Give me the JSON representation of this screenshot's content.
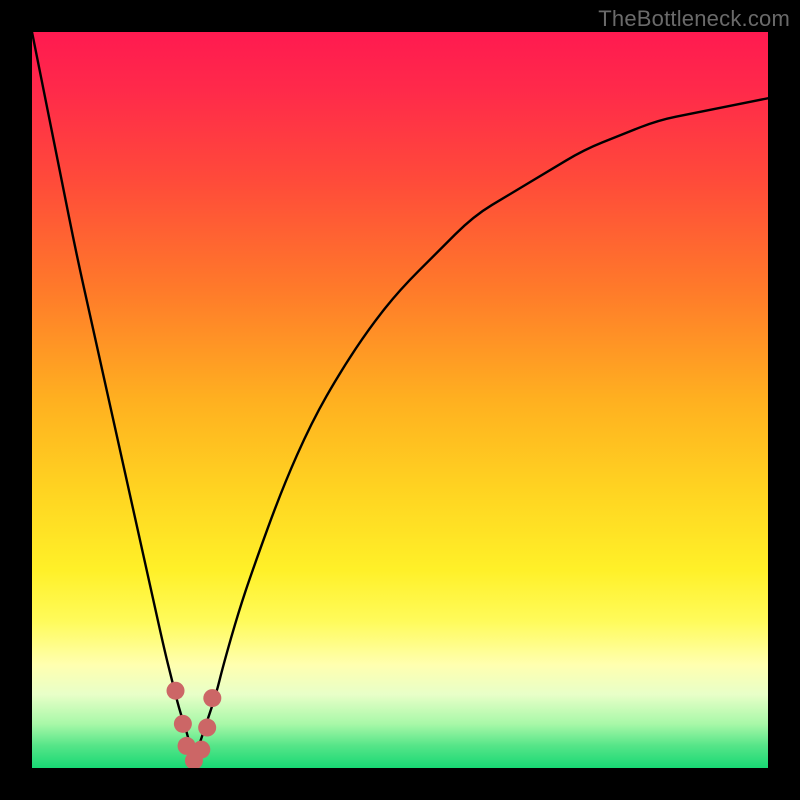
{
  "attribution": "TheBottleneck.com",
  "chart_data": {
    "type": "line",
    "title": "",
    "xlabel": "",
    "ylabel": "",
    "xlim": [
      0,
      100
    ],
    "ylim": [
      0,
      100
    ],
    "min_x": 22,
    "series": [
      {
        "name": "bottleneck-curve",
        "x": [
          0,
          2,
          4,
          6,
          8,
          10,
          12,
          14,
          16,
          18,
          19,
          20,
          21,
          22,
          23,
          24,
          25,
          26,
          28,
          30,
          34,
          38,
          42,
          46,
          50,
          55,
          60,
          65,
          70,
          75,
          80,
          85,
          90,
          95,
          100
        ],
        "y": [
          100,
          90,
          80,
          70,
          61,
          52,
          43,
          34,
          25,
          16,
          12,
          8,
          5,
          1,
          4,
          7,
          10,
          14,
          21,
          27,
          38,
          47,
          54,
          60,
          65,
          70,
          75,
          78,
          81,
          84,
          86,
          88,
          89,
          90,
          91
        ]
      }
    ],
    "highlight": {
      "name": "near-minimum-markers",
      "color": "#cc6666",
      "x": [
        19.5,
        20.5,
        21.0,
        22.0,
        23.0,
        23.8,
        24.5
      ],
      "y": [
        10.5,
        6.0,
        3.0,
        1.0,
        2.5,
        5.5,
        9.5
      ]
    },
    "gradient_stops": [
      {
        "offset": 0.0,
        "color": "#ff1a50"
      },
      {
        "offset": 0.08,
        "color": "#ff2a4a"
      },
      {
        "offset": 0.2,
        "color": "#ff4a3a"
      },
      {
        "offset": 0.35,
        "color": "#ff7a2a"
      },
      {
        "offset": 0.5,
        "color": "#ffb020"
      },
      {
        "offset": 0.62,
        "color": "#ffd321"
      },
      {
        "offset": 0.73,
        "color": "#fff028"
      },
      {
        "offset": 0.8,
        "color": "#fffb5a"
      },
      {
        "offset": 0.86,
        "color": "#ffffb0"
      },
      {
        "offset": 0.9,
        "color": "#e8ffc8"
      },
      {
        "offset": 0.94,
        "color": "#a8f8a8"
      },
      {
        "offset": 0.97,
        "color": "#55e588"
      },
      {
        "offset": 1.0,
        "color": "#18d874"
      }
    ]
  }
}
